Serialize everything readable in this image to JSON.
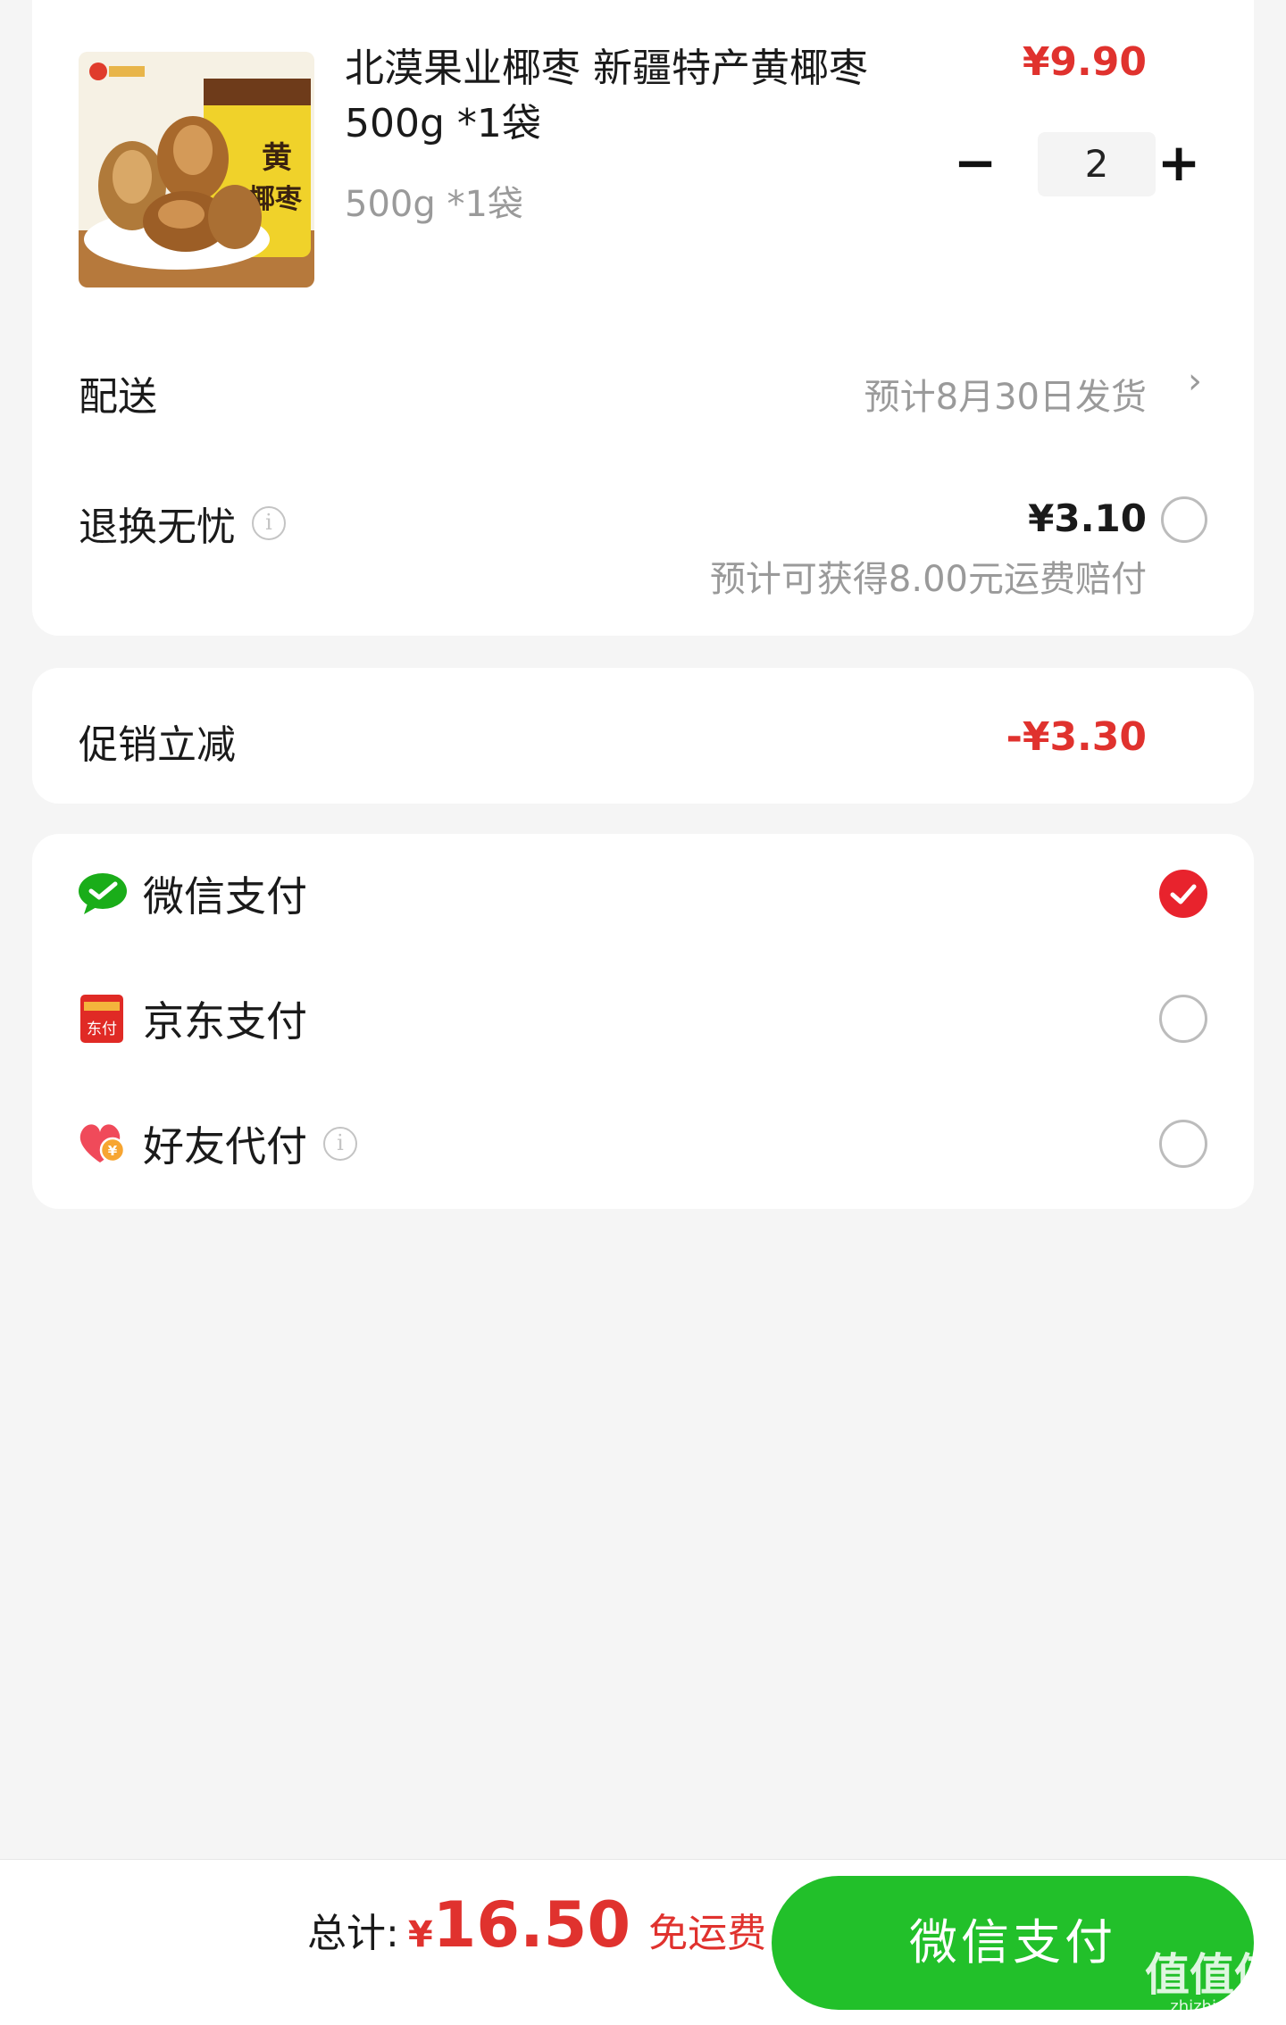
{
  "product": {
    "title": "北漠果业椰枣 新疆特产黄椰枣500g *1袋",
    "spec": "500g *1袋",
    "price": "¥9.90",
    "quantity": "2",
    "minus_symbol": "−",
    "plus_symbol": "+",
    "image_icon": "dates-product-thumbnail"
  },
  "delivery": {
    "label": "配送",
    "value": "预计8月30日发货",
    "arrow": "›"
  },
  "return_insurance": {
    "label": "退换无忧",
    "info_glyph": "i",
    "price": "¥3.10",
    "sub": "预计可获得8.00元运费赔付",
    "selected": false
  },
  "promotion": {
    "label": "促销立减",
    "value": "-¥3.30"
  },
  "payment_methods": [
    {
      "id": "wechat",
      "label": "微信支付",
      "icon": "wechat-pay-icon",
      "selected": true
    },
    {
      "id": "jd",
      "label": "京东支付",
      "icon": "jd-pay-icon",
      "selected": false,
      "icon_text": "东付"
    },
    {
      "id": "friend",
      "label": "好友代付",
      "icon": "friend-pay-icon",
      "selected": false,
      "info_glyph": "i"
    }
  ],
  "bottom_bar": {
    "total_label": "总计:",
    "currency": "¥",
    "total_amount": "16.50",
    "free_shipping": "免运费",
    "pay_button": "微信支付"
  },
  "watermark": {
    "text": "值值值",
    "sub": "zhizhizhi.com"
  },
  "colors": {
    "price_red": "#e0322e",
    "pay_green": "#22c02a",
    "check_red": "#e8232d",
    "background": "#f5f5f5"
  }
}
